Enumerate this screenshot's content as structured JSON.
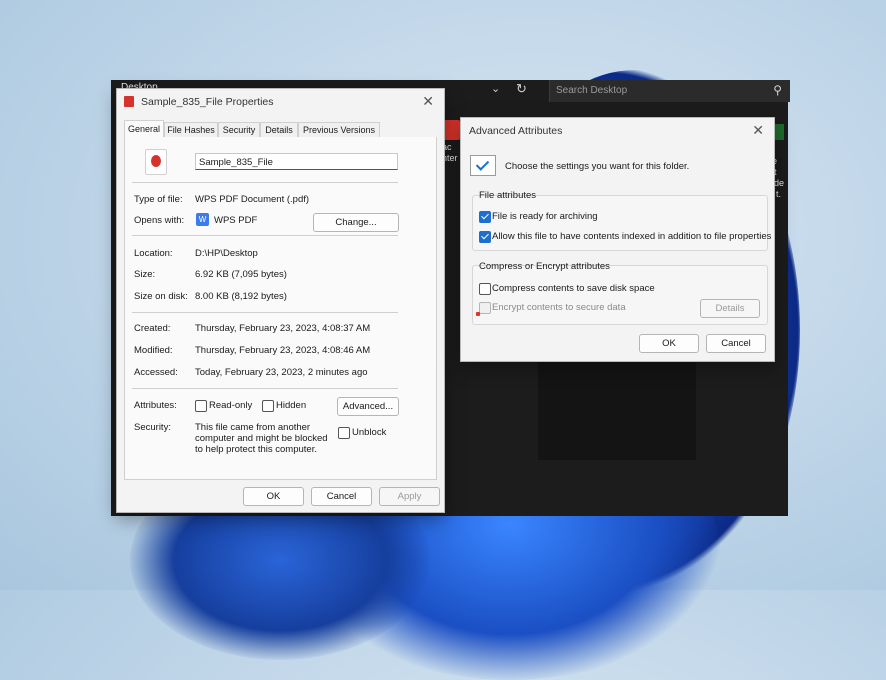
{
  "explorer": {
    "title": "Desktop",
    "search_placeholder": "Search Desktop",
    "file_stub_text": "ac\nnter",
    "right_stub_text": "de\ns t\nuide\nw t."
  },
  "properties": {
    "title": "Sample_835_File Properties",
    "tabs": [
      "General",
      "File Hashes",
      "Security",
      "Details",
      "Previous Versions"
    ],
    "active_tab": "General",
    "file_name": "Sample_835_File",
    "type_label": "Type of file:",
    "type_value": "WPS PDF Document (.pdf)",
    "opens_label": "Opens with:",
    "opens_value": "WPS PDF",
    "change_button": "Change...",
    "location_label": "Location:",
    "location_value": "D:\\HP\\Desktop",
    "size_label": "Size:",
    "size_value": "6.92 KB (7,095 bytes)",
    "size_disk_label": "Size on disk:",
    "size_disk_value": "8.00 KB (8,192 bytes)",
    "created_label": "Created:",
    "created_value": "Thursday, February 23, 2023, 4:08:37 AM",
    "modified_label": "Modified:",
    "modified_value": "Thursday, February 23, 2023, 4:08:46 AM",
    "accessed_label": "Accessed:",
    "accessed_value": "Today, February 23, 2023, 2 minutes ago",
    "attributes_label": "Attributes:",
    "readonly_label": "Read-only",
    "hidden_label": "Hidden",
    "advanced_button": "Advanced...",
    "security_label": "Security:",
    "security_text": "This file came from another computer and might be blocked to help protect this computer.",
    "unblock_label": "Unblock",
    "ok": "OK",
    "cancel": "Cancel",
    "apply": "Apply"
  },
  "advanced": {
    "title": "Advanced Attributes",
    "intro": "Choose the settings you want for this folder.",
    "file_attributes_title": "File attributes",
    "archive_label": "File is ready for archiving",
    "archive_checked": true,
    "index_label": "Allow this file to have contents indexed in addition to file properties",
    "index_checked": true,
    "compress_title": "Compress or Encrypt attributes",
    "compress_label": "Compress contents to save disk space",
    "encrypt_label": "Encrypt contents to secure data",
    "details_button": "Details",
    "ok": "OK",
    "cancel": "Cancel"
  }
}
